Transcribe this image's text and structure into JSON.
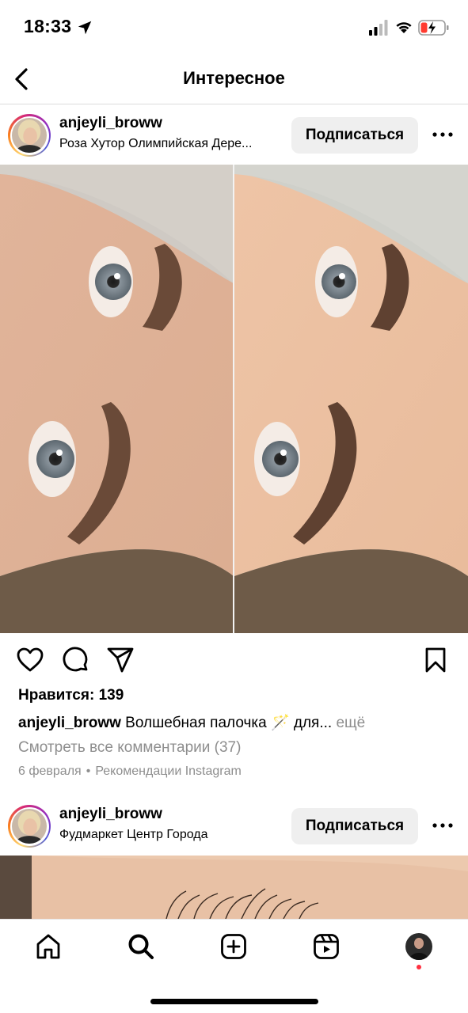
{
  "status_bar": {
    "time": "18:33",
    "icons": [
      "location-arrow-icon",
      "cellular-signal-icon",
      "wifi-icon",
      "battery-charging-icon"
    ],
    "battery_color": "#ff3b30"
  },
  "header": {
    "title": "Интересное",
    "back_icon": "chevron-left-icon"
  },
  "posts": [
    {
      "username": "anjeyli_broww",
      "location": "Роза Хутор Олимпийская Дере...",
      "follow_label": "Подписаться",
      "more_icon": "more-horizontal-icon",
      "likes": "Нравится: 139",
      "caption_user": "anjeyli_broww",
      "caption_text": "Волшебная палочка 🪄 для...",
      "caption_more": "ещё",
      "view_comments": "Смотреть все комментарии (37)",
      "date": "6 февраля",
      "source": "Рекомендации Instagram"
    },
    {
      "username": "anjeyli_broww",
      "location": "Фудмаркет Центр Города",
      "follow_label": "Подписаться",
      "more_icon": "more-horizontal-icon"
    }
  ],
  "actions": [
    "heart-icon",
    "comment-icon",
    "share-icon",
    "bookmark-icon"
  ],
  "tab_bar": [
    "home-icon",
    "search-icon",
    "new-post-icon",
    "reels-icon",
    "profile-avatar"
  ],
  "colors": {
    "follow_button_bg": "#efefef",
    "secondary_text": "#8e8e8e",
    "notification_dot": "#ff3040"
  }
}
